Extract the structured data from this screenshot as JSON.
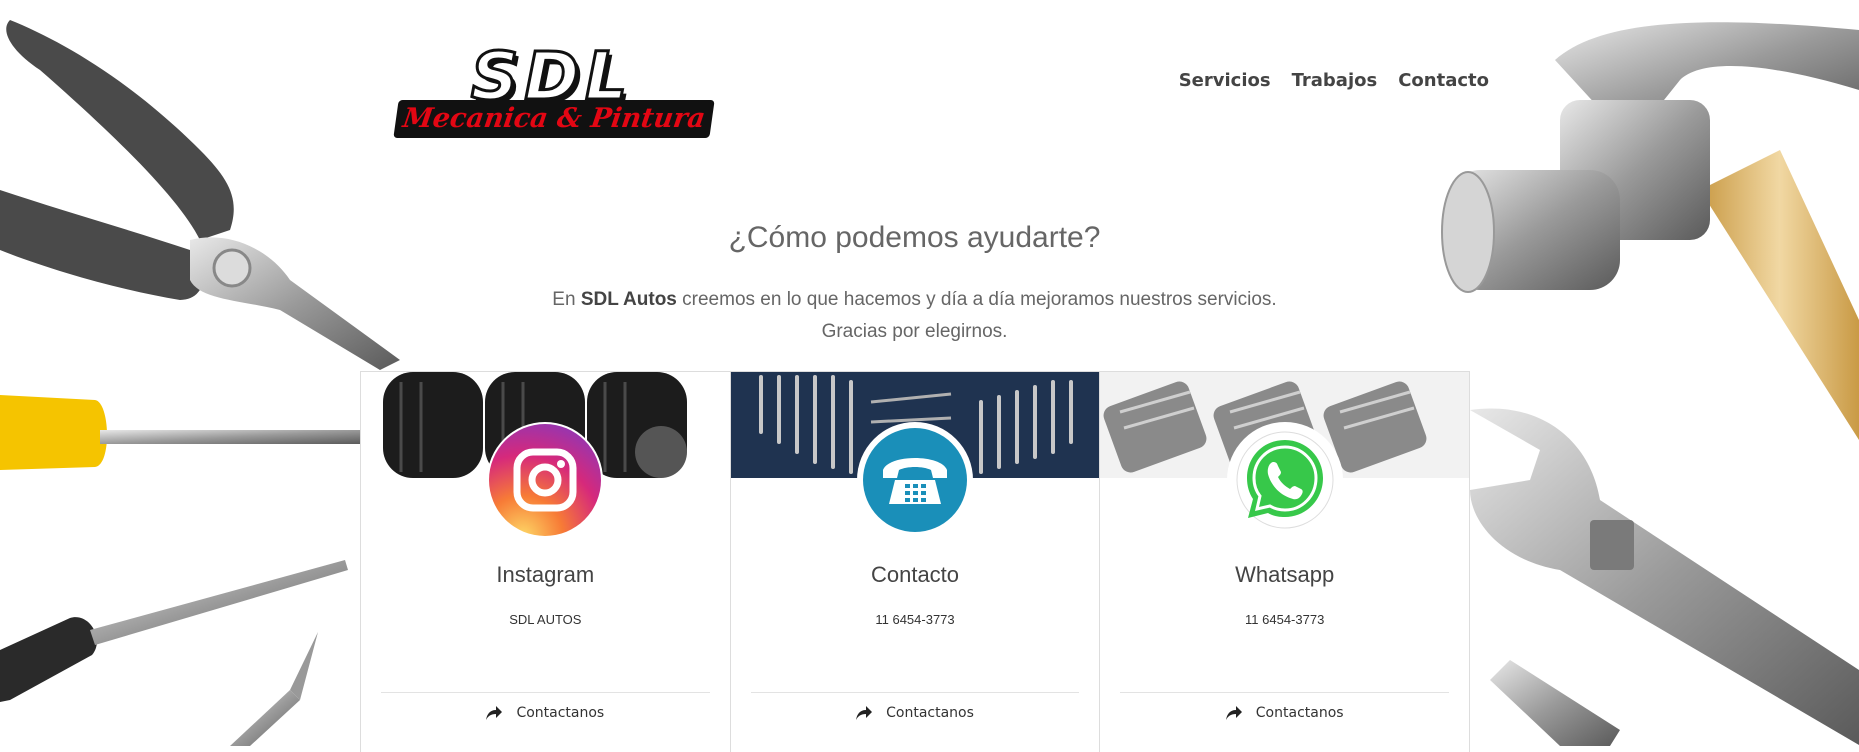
{
  "brand": {
    "logo_text": "SDL",
    "logo_subtitle": "Mecanica & Pintura",
    "logo_accent_color": "#e30613"
  },
  "nav": {
    "items": [
      {
        "label": "Servicios"
      },
      {
        "label": "Trabajos"
      },
      {
        "label": "Contacto"
      }
    ]
  },
  "hero": {
    "heading": "¿Cómo podemos ayudarte?",
    "intro_prefix": "En ",
    "intro_brand": "SDL Autos",
    "intro_suffix": " creemos en lo que hacemos y día a día mejoramos nuestros servicios.",
    "intro_line2": "Gracias por elegirnos."
  },
  "cards": [
    {
      "title": "Instagram",
      "text": "SDL AUTOS",
      "action_label": "Contactanos",
      "icon": "instagram-icon",
      "banner": "tires"
    },
    {
      "title": "Contacto",
      "text": "11 6454-3773",
      "action_label": "Contactanos",
      "icon": "telephone-icon",
      "banner": "wrenches",
      "icon_color": "#1a8fb9"
    },
    {
      "title": "Whatsapp",
      "text": "11 6454-3773",
      "action_label": "Contactanos",
      "icon": "whatsapp-icon",
      "banner": "spark-plugs",
      "icon_color": "#37c84a"
    }
  ]
}
